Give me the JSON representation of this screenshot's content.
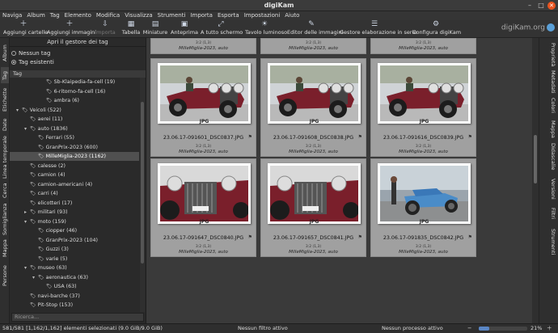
{
  "window": {
    "title": "digiKam"
  },
  "menu": [
    "Naviga",
    "Album",
    "Tag",
    "Elemento",
    "Modifica",
    "Visualizza",
    "Strumenti",
    "Importa",
    "Esporta",
    "Impostazioni",
    "Aiuto"
  ],
  "toolbar": {
    "add_folders": "Aggiungi cartelle",
    "add_images": "Aggiungi immagini",
    "import": "Importa",
    "table": "Tabella",
    "thumbnails": "Miniature",
    "preview": "Anteprima",
    "fullscreen": "A tutto schermo",
    "lighttable": "Tavolo luminoso",
    "image_editor": "Editor delle immagini",
    "batch_queue": "Gestore elaborazione in serie",
    "configure": "Configura digiKam",
    "brand": "digiKam.org"
  },
  "left_tabs": [
    "Album",
    "Tag",
    "Etichette",
    "Date",
    "Linea temporale",
    "Cerca",
    "Somiglianza",
    "Mappa",
    "Persone"
  ],
  "right_tabs": [
    "Proprietà",
    "Metadati",
    "Colori",
    "Mappa",
    "Didascalie",
    "Versioni",
    "Filtri",
    "Strumenti"
  ],
  "left_panel": {
    "header": "Apri il gestore dei tag",
    "radio_none": "Nessun tag",
    "radio_existing": "Tag esistenti",
    "tree_header": "Tag",
    "search_placeholder": "Ricerca..."
  },
  "tags": [
    {
      "label": "Sb-Klaipedia-fa-cell (19)",
      "indent": 3,
      "arrow": ""
    },
    {
      "label": "6-ritorno-fa-cell (16)",
      "indent": 3,
      "arrow": ""
    },
    {
      "label": "ambra (6)",
      "indent": 3,
      "arrow": ""
    },
    {
      "label": "Veicoli (522)",
      "indent": 0,
      "arrow": "▾"
    },
    {
      "label": "aerei (11)",
      "indent": 1,
      "arrow": ""
    },
    {
      "label": "auto (1836)",
      "indent": 1,
      "arrow": "▾"
    },
    {
      "label": "Ferrari (55)",
      "indent": 2,
      "arrow": ""
    },
    {
      "label": "GranPrix-2023 (600)",
      "indent": 2,
      "arrow": ""
    },
    {
      "label": "MilleMiglia-2023 (1162)",
      "indent": 2,
      "arrow": "",
      "selected": true
    },
    {
      "label": "calesse (2)",
      "indent": 1,
      "arrow": ""
    },
    {
      "label": "camion (4)",
      "indent": 1,
      "arrow": ""
    },
    {
      "label": "camion-americani (4)",
      "indent": 1,
      "arrow": ""
    },
    {
      "label": "carri (4)",
      "indent": 1,
      "arrow": ""
    },
    {
      "label": "elicotteri (17)",
      "indent": 1,
      "arrow": ""
    },
    {
      "label": "militari (93)",
      "indent": 1,
      "arrow": "▸"
    },
    {
      "label": "moto (159)",
      "indent": 1,
      "arrow": "▾"
    },
    {
      "label": "ciopper (46)",
      "indent": 2,
      "arrow": ""
    },
    {
      "label": "GranPrix-2023 (104)",
      "indent": 2,
      "arrow": ""
    },
    {
      "label": "Guzzi (3)",
      "indent": 2,
      "arrow": ""
    },
    {
      "label": "varie (5)",
      "indent": 2,
      "arrow": ""
    },
    {
      "label": "museo (63)",
      "indent": 1,
      "arrow": "▾"
    },
    {
      "label": "aeronautica (63)",
      "indent": 2,
      "arrow": "▾"
    },
    {
      "label": "USA (63)",
      "indent": 3,
      "arrow": ""
    },
    {
      "label": "navi-barche (37)",
      "indent": 1,
      "arrow": ""
    },
    {
      "label": "Pit-Stop (153)",
      "indent": 1,
      "arrow": ""
    }
  ],
  "top_cells": [
    {
      "dims": "3:2 (1,3)",
      "album": "MilleMiglia-2023, auto"
    },
    {
      "dims": "3:2 (1,3)",
      "album": "MilleMiglia-2023, auto"
    },
    {
      "dims": "3:2 (1,3)",
      "album": "MilleMiglia-2023, auto"
    }
  ],
  "thumbnails": [
    {
      "name": "23.06.17-091601_DSC0837.JPG",
      "dims": "3:2 (1,3)",
      "album": "MilleMiglia-2023, auto",
      "badge": "JPG",
      "car": "red"
    },
    {
      "name": "23.06.17-091608_DSC0838.JPG",
      "dims": "3:2 (1,3)",
      "album": "MilleMiglia-2023, auto",
      "badge": "JPG",
      "car": "red"
    },
    {
      "name": "23.06.17-091616_DSC0839.JPG",
      "dims": "3:2 (1,3)",
      "album": "MilleMiglia-2023, auto",
      "badge": "JPG",
      "car": "red"
    },
    {
      "name": "23.06.17-091647_DSC0840.JPG",
      "dims": "3:2 (1,3)",
      "album": "MilleMiglia-2023, auto",
      "badge": "JPG",
      "car": "red-close"
    },
    {
      "name": "23.06.17-091657_DSC0841.JPG",
      "dims": "3:2 (1,3)",
      "album": "MilleMiglia-2023, auto",
      "badge": "JPG",
      "car": "red-close"
    },
    {
      "name": "23.06.17-091835_DSC0842.JPG",
      "dims": "3:2 (1,3)",
      "album": "MilleMiglia-2023, auto",
      "badge": "JPG",
      "car": "blue"
    }
  ],
  "status": {
    "left": "581/581 [1,162/1,162] elementi selezionati (9.0 GiB/9.0 GiB)",
    "filter": "Nessun filtro attivo",
    "process": "Nessun processo attivo",
    "zoom": "21%",
    "zoom_fraction": 0.21
  },
  "colors": {
    "selection": "#505050",
    "accent": "#5a86c5",
    "car_red": "#7a1f2b",
    "car_blue": "#4a8cc8"
  }
}
